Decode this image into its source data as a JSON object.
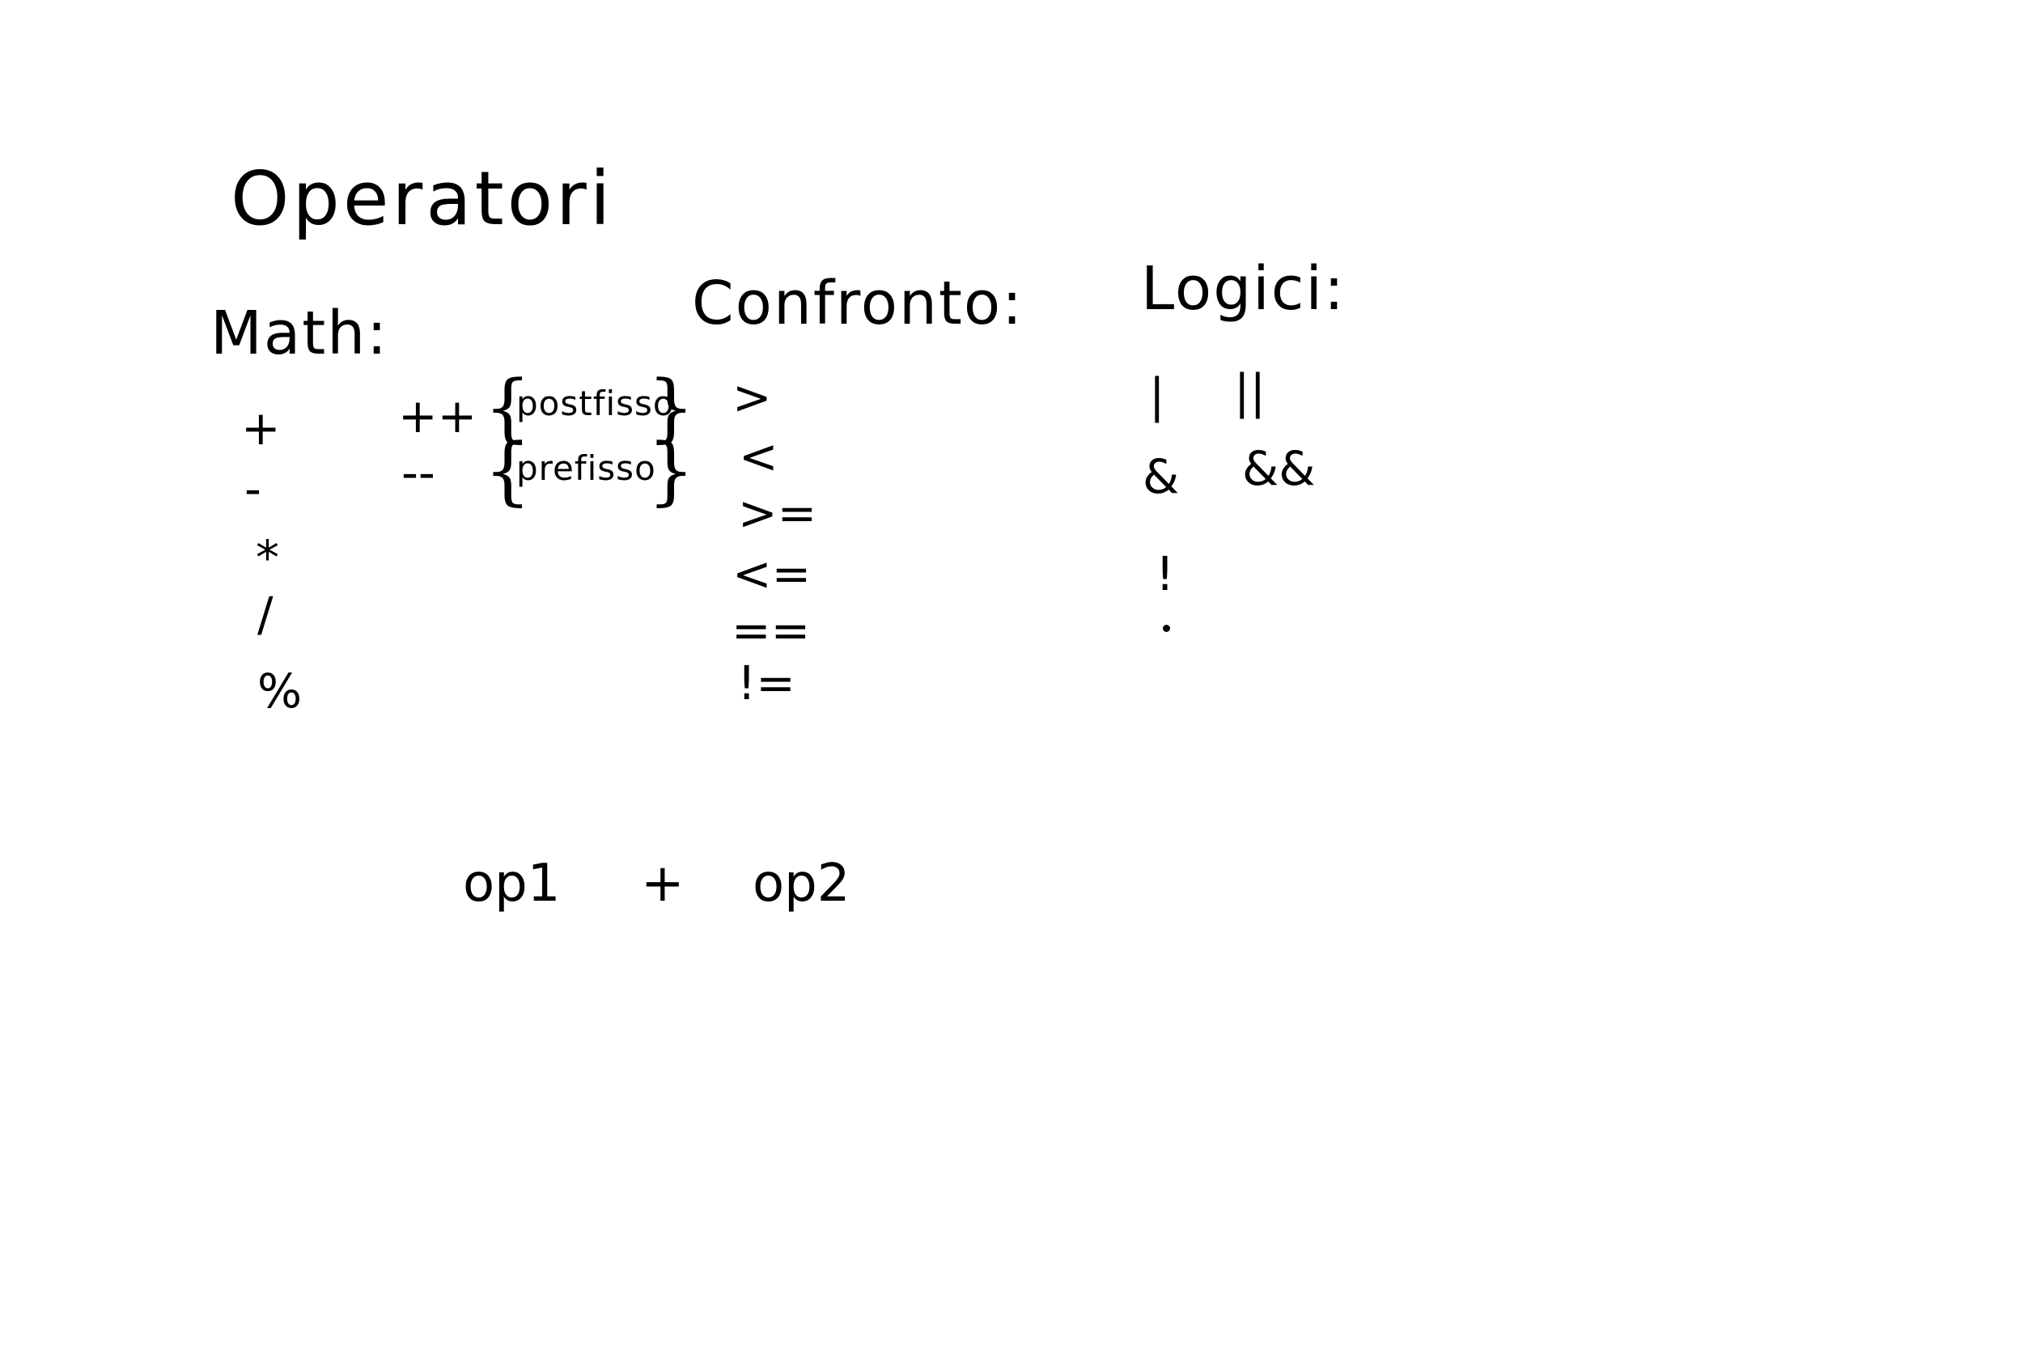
{
  "title": "Operatori",
  "sections": {
    "math": {
      "heading": "Math:",
      "operators": [
        "+",
        "-",
        "*",
        "/",
        "%"
      ],
      "increment": {
        "operators": [
          "++",
          "--"
        ],
        "notes": [
          "postfisso",
          "prefisso"
        ]
      }
    },
    "confronto": {
      "heading": "Confronto:",
      "operators": [
        ">",
        "<",
        ">=",
        "<=",
        "==",
        "!="
      ]
    },
    "logici": {
      "heading": "Logici:",
      "operators": [
        "|",
        "||",
        "&",
        "&&",
        "!"
      ]
    }
  },
  "expression": {
    "left": "op1",
    "operator": "+",
    "right": "op2"
  }
}
